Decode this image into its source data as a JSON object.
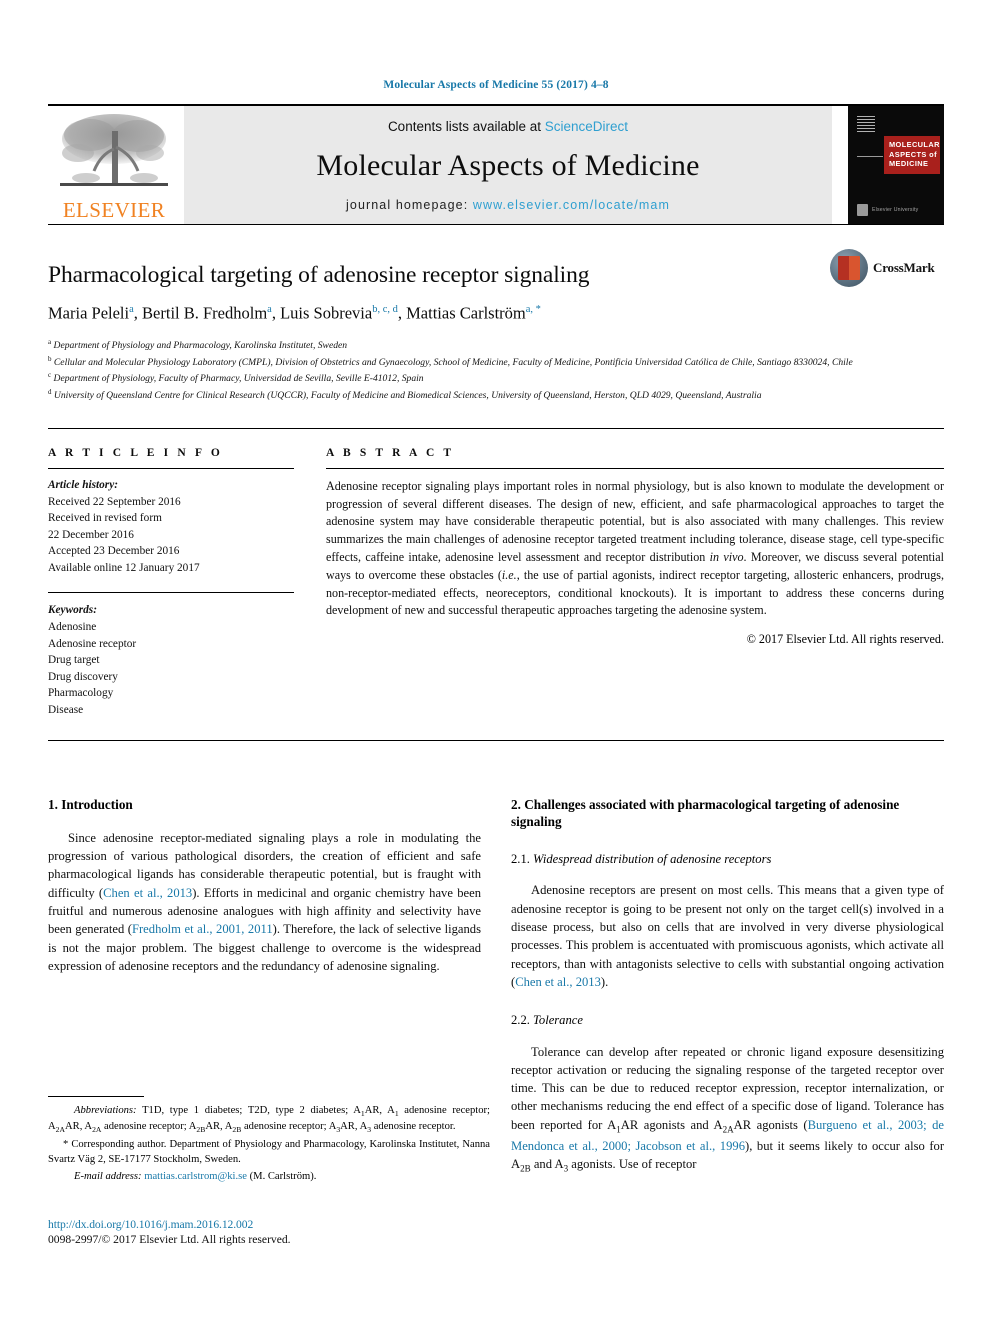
{
  "running_head": "Molecular Aspects of Medicine 55 (2017) 4–8",
  "masthead": {
    "publisher_name": "ELSEVIER",
    "contents_prefix": "Contents lists available at ",
    "contents_link": "ScienceDirect",
    "journal_title": "Molecular Aspects of Medicine",
    "homepage_prefix": "journal homepage: ",
    "homepage_url": "www.elsevier.com/locate/mam",
    "cover_title_lines": [
      "MOLECULAR",
      "ASPECTS of",
      "MEDICINE"
    ],
    "cover_footer": "Elsevier University"
  },
  "article": {
    "title": "Pharmacological targeting of adenosine receptor signaling",
    "authors": [
      {
        "name": "Maria Peleli",
        "marks": "a"
      },
      {
        "name": "Bertil B. Fredholm",
        "marks": "a"
      },
      {
        "name": "Luis Sobrevia",
        "marks": "b, c, d"
      },
      {
        "name": "Mattias Carlström",
        "marks": "a, *"
      }
    ],
    "affiliations": [
      {
        "mark": "a",
        "text": "Department of Physiology and Pharmacology, Karolinska Institutet, Sweden"
      },
      {
        "mark": "b",
        "text": "Cellular and Molecular Physiology Laboratory (CMPL), Division of Obstetrics and Gynaecology, School of Medicine, Faculty of Medicine, Pontificia Universidad Católica de Chile, Santiago 8330024, Chile"
      },
      {
        "mark": "c",
        "text": "Department of Physiology, Faculty of Pharmacy, Universidad de Sevilla, Seville E-41012, Spain"
      },
      {
        "mark": "d",
        "text": "University of Queensland Centre for Clinical Research (UQCCR), Faculty of Medicine and Biomedical Sciences, University of Queensland, Herston, QLD 4029, Queensland, Australia"
      }
    ],
    "crossmark_label": "CrossMark"
  },
  "article_info": {
    "heading": "A R T I C L E   I N F O",
    "history_label": "Article history:",
    "history": [
      "Received 22 September 2016",
      "Received in revised form",
      "22 December 2016",
      "Accepted 23 December 2016",
      "Available online 12 January 2017"
    ],
    "keywords_label": "Keywords:",
    "keywords": [
      "Adenosine",
      "Adenosine receptor",
      "Drug target",
      "Drug discovery",
      "Pharmacology",
      "Disease"
    ]
  },
  "abstract": {
    "heading": "A B S T R A C T",
    "part1": "Adenosine receptor signaling plays important roles in normal physiology, but is also known to modulate the development or progression of several different diseases. The design of new, efficient, and safe pharmacological approaches to target the adenosine system may have considerable therapeutic potential, but is also associated with many challenges. This review summarizes the main challenges of adenosine receptor targeted treatment including tolerance, disease stage, cell type-specific effects, caffeine intake, adenosine level assessment and receptor distribution ",
    "italic1": "in vivo",
    "part2": ". Moreover, we discuss several potential ways to overcome these obstacles (",
    "italic2": "i.e.",
    "part3": ", the use of partial agonists, indirect receptor targeting, allosteric enhancers, prodrugs, non-receptor-mediated effects, neoreceptors, conditional knockouts). It is important to address these concerns during development of new and successful therapeutic approaches targeting the adenosine system.",
    "copyright": "© 2017 Elsevier Ltd. All rights reserved."
  },
  "sections": {
    "s1_heading": "1. Introduction",
    "s1_p1_a": "Since adenosine receptor-mediated signaling plays a role in modulating the progression of various pathological disorders, the creation of efficient and safe pharmacological ligands has considerable therapeutic potential, but is fraught with difficulty (",
    "s1_ref1": "Chen et al., 2013",
    "s1_p1_b": "). Efforts in medicinal and organic chemistry have been fruitful and numerous adenosine analogues with high affinity and selectivity have been generated (",
    "s1_ref2": "Fredholm et al., 2001, 2011",
    "s1_p1_c": "). Therefore, the lack of selective ligands is not the major problem. The biggest challenge to overcome is the widespread expression of adenosine receptors and the redundancy of adenosine signaling.",
    "s2_heading": "2. Challenges associated with pharmacological targeting of adenosine signaling",
    "s2_1_num": "2.1.",
    "s2_1_title": "Widespread distribution of adenosine receptors",
    "s2_1_p_a": "Adenosine receptors are present on most cells. This means that a given type of adenosine receptor is going to be present not only on the target cell(s) involved in a disease process, but also on cells that are involved in very diverse physiological processes. This problem is accentuated with promiscuous agonists, which activate all receptors, than with antagonists selective to cells with substantial ongoing activation (",
    "s2_1_ref": "Chen et al., 2013",
    "s2_1_p_b": ").",
    "s2_2_num": "2.2.",
    "s2_2_title": "Tolerance",
    "s2_2_p_a": "Tolerance can develop after repeated or chronic ligand exposure desensitizing receptor activation or reducing the signaling response of the targeted receptor over time. This can be due to reduced receptor expression, receptor internalization, or other mechanisms reducing the end effect of a specific dose of ligand. Tolerance has been reported for A",
    "s2_2_sub1": "1",
    "s2_2_p_b": "AR agonists and A",
    "s2_2_sub2": "2A",
    "s2_2_p_c": "AR agonists (",
    "s2_2_ref": "Burgueno et al., 2003; de Mendonca et al., 2000; Jacobson et al., 1996",
    "s2_2_p_d": "), but it seems likely to occur also for A",
    "s2_2_sub3": "2B",
    "s2_2_p_e": " and A",
    "s2_2_sub4": "3",
    "s2_2_p_f": " agonists. Use of receptor"
  },
  "footnotes": {
    "abbrev_label": "Abbreviations:",
    "abbrev_a": " T1D, type 1 diabetes; T2D, type 2 diabetes; A",
    "abbrev_sub1": "1",
    "abbrev_b": "AR, A",
    "abbrev_sub2": "1",
    "abbrev_c": " adenosine receptor; A",
    "abbrev_sub3": "2A",
    "abbrev_d": "AR, A",
    "abbrev_sub4": "2A",
    "abbrev_e": " adenosine receptor; A",
    "abbrev_sub5": "2B",
    "abbrev_f": "AR, A",
    "abbrev_sub6": "2B",
    "abbrev_g": " adenosine receptor; A",
    "abbrev_sub7": "3",
    "abbrev_h": "AR, A",
    "abbrev_sub8": "3",
    "abbrev_i": " adenosine receptor.",
    "corresponding": "* Corresponding author. Department of Physiology and Pharmacology, Karolinska Institutet, Nanna Svartz Väg 2, SE-17177 Stockholm, Sweden.",
    "email_label": "E-mail address:",
    "email": "mattias.carlstrom@ki.se",
    "email_suffix": " (M. Carlström).",
    "doi": "http://dx.doi.org/10.1016/j.mam.2016.12.002",
    "issn": "0098-2997/© 2017 Elsevier Ltd. All rights reserved."
  },
  "colors": {
    "link_blue": "#1878a8",
    "sd_blue": "#2f9fd0",
    "elsevier_orange": "#f08222",
    "masthead_grey": "#e9e9e9",
    "cover_red": "#a9201c"
  }
}
